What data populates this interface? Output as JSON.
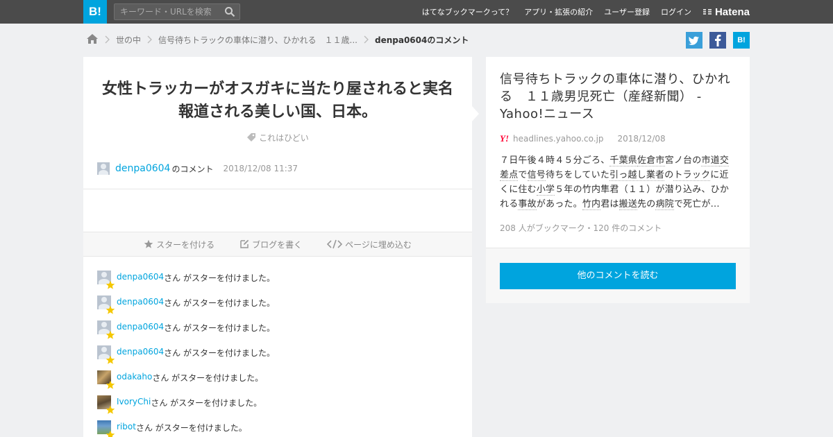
{
  "topbar": {
    "logo": "B!",
    "search_placeholder": "キーワード・URLを検索",
    "nav": [
      "はてなブックマークって？",
      "アプリ・拡張の紹介",
      "ユーザー登録",
      "ログイン"
    ],
    "hatena_label": "Hatena"
  },
  "breadcrumb": {
    "items": [
      "世の中",
      "信号待ちトラックの車体に潜り、ひかれる　１１歳..."
    ],
    "current": "denpa0604のコメント"
  },
  "share": {
    "hatebu_label": "B!"
  },
  "comment": {
    "text": "女性トラッカーがオスガキに当たり屋されると実名報道される美しい国、日本。",
    "tag": "これはひどい",
    "user": "denpa0604",
    "user_suffix": "のコメント",
    "datetime": "2018/12/08 11:37"
  },
  "actions": {
    "star": "スターを付ける",
    "blog": "ブログを書く",
    "embed": "ページに埋め込む"
  },
  "stars": {
    "suffix": "さん がスターを付けました。",
    "users": [
      "denpa0604",
      "denpa0604",
      "denpa0604",
      "denpa0604",
      "odakaho",
      "IvoryChi",
      "ribot"
    ]
  },
  "entry": {
    "title": "信号待ちトラックの車体に潜り、ひかれる　１１歳男児死亡（産経新聞） - Yahoo!ニュース",
    "domain": "headlines.yahoo.co.jp",
    "date": "2018/12/08",
    "summary_parts": [
      {
        "t": "７日午後４時４５分ごろ、",
        "l": false
      },
      {
        "t": "千葉県",
        "l": true
      },
      {
        "t": "佐倉市",
        "l": true
      },
      {
        "t": "宮ノ台",
        "l": false
      },
      {
        "t": "の",
        "l": false
      },
      {
        "t": "市道",
        "l": true
      },
      {
        "t": "交差点",
        "l": true
      },
      {
        "t": "で",
        "l": false
      },
      {
        "t": "信号",
        "l": true
      },
      {
        "t": "待ちをしていた",
        "l": false
      },
      {
        "t": "引っ越し業者",
        "l": true
      },
      {
        "t": "の",
        "l": false
      },
      {
        "t": "トラック",
        "l": true
      },
      {
        "t": "に近くに住む",
        "l": false
      },
      {
        "t": "小学",
        "l": true
      },
      {
        "t": "５年の竹内隼君（１１）が潜り込み、ひかれる",
        "l": false
      },
      {
        "t": "事故",
        "l": true
      },
      {
        "t": "があった。",
        "l": false
      },
      {
        "t": "竹内",
        "l": true
      },
      {
        "t": "君は",
        "l": false
      },
      {
        "t": "搬送",
        "l": true
      },
      {
        "t": "先の",
        "l": false
      },
      {
        "t": "病院",
        "l": true
      },
      {
        "t": "で死亡が...",
        "l": false
      }
    ],
    "counts": "208 人がブックマーク・120 件のコメント",
    "read_more": "他のコメントを読む"
  },
  "colors": {
    "accent": "#00a4de",
    "topbar": "#4b4b4b",
    "star": "#f5c800"
  }
}
